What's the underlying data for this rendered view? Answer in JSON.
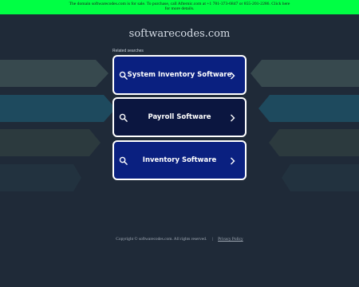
{
  "banner": {
    "line1": "The domain softwarecodes.com is for sale. To purchase, call Afternic.com at +1 781-373-6847 or 855-201-2286. Click here",
    "line2": "for more details."
  },
  "site": {
    "title": "softwarecodes.com"
  },
  "related": {
    "heading": "Related searches",
    "items": [
      {
        "label": "System Inventory Software",
        "icon": "search-icon",
        "chevron": "chevron-right-icon"
      },
      {
        "label": "Payroll Software",
        "icon": "search-icon",
        "chevron": "chevron-right-icon"
      },
      {
        "label": "Inventory Software",
        "icon": "search-icon",
        "chevron": "chevron-right-icon"
      }
    ]
  },
  "footer": {
    "copyright": "Copyright © softwarecodes.com.  All rights reserved.",
    "separator": "|",
    "privacy": "Privacy Policy"
  },
  "colors": {
    "background": "#1f2a38",
    "banner": "#00ff44",
    "button": "#0a2080",
    "button_hovered": "#0b1640",
    "button_border": "#ffffff"
  }
}
